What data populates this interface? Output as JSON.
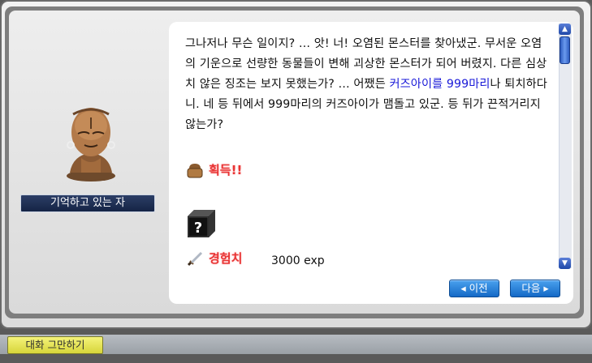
{
  "npc": {
    "name": "기억하고 있는 자"
  },
  "dialog": {
    "text_before": "그나저나 무슨 일이지? … 앗! 너! 오염된 몬스터를 찾아냈군. 무서운 오염의 기운으로 선량한 동물들이 변해 괴상한 몬스터가 되어 버렸지. 다른 심상치 않은 징조는 보지 못했는가? … 어쨌든 ",
    "highlight": "커즈아이를 999마리",
    "text_after": "나 퇴치하다니. 네 등 뒤에서 999마리의 커즈아이가 맴돌고 있군. 등 뒤가 끈적거리지 않는가?"
  },
  "rewards": {
    "obtain_label": "획득!!",
    "exp_label": "경험치",
    "exp_value": "3000 exp",
    "unknown_item_glyph": "?"
  },
  "buttons": {
    "prev": "◂ 이전",
    "next": "다음 ▸",
    "end_chat": "대화 그만하기"
  },
  "scroll": {
    "up": "▲",
    "down": "▼"
  },
  "colors": {
    "highlight": "#1919d8",
    "reward_label": "#e83333",
    "nav_button": "#1f7bd6"
  }
}
